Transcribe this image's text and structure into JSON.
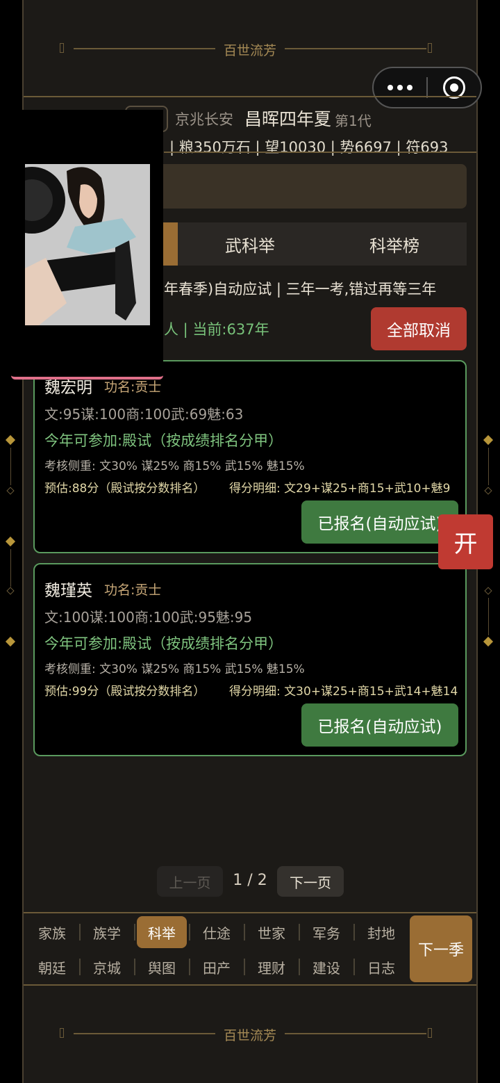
{
  "header_title": "百世流芳",
  "footer_title": "百世流芳",
  "status": {
    "location": "京兆长安",
    "era": "昌晖四年夏",
    "generation": "第1代",
    "stats": "| 粮350万石 | 望10030 | 势6697 | 符693"
  },
  "tabs": [
    {
      "label": ""
    },
    {
      "label": "武科举"
    },
    {
      "label": "科举榜"
    }
  ],
  "info": {
    "line1": "年春季)自动应试 | 三年一考,错过再等三年",
    "line2": "人 | 当前:637年",
    "cancel_all": "全部取消"
  },
  "candidates": [
    {
      "name": "魏宏明",
      "rank": "功名:贡士",
      "attrs": "文:95谋:100商:100武:69魅:63",
      "eligible": "今年可参加:殿试（按成绩排名分甲）",
      "weights": "考核侧重: 文30% 谋25% 商15% 武15% 魅15%",
      "estimate": "预估:88分（殿试按分数排名）",
      "detail": "得分明细: 文29+谋25+商15+武10+魅9",
      "button": "已报名(自动应试)"
    },
    {
      "name": "魏瑾英",
      "rank": "功名:贡士",
      "attrs": "文:100谋:100商:100武:95魅:95",
      "eligible": "今年可参加:殿试（按成绩排名分甲）",
      "weights": "考核侧重: 文30% 谋25% 商15% 武15% 魅15%",
      "estimate": "预估:99分（殿试按分数排名）",
      "detail": "得分明细: 文30+谋25+商15+武14+魅14",
      "button": "已报名(自动应试)"
    }
  ],
  "open_button": "开",
  "pager": {
    "prev": "上一页",
    "current": "1 / 2",
    "next": "下一页"
  },
  "nav": {
    "row1": [
      "家族",
      "族学",
      "科举",
      "仕途",
      "世家",
      "军务",
      "封地"
    ],
    "row2": [
      "朝廷",
      "京城",
      "舆图",
      "田产",
      "理财",
      "建设",
      "日志"
    ],
    "active": "科举",
    "next_season": "下一季"
  },
  "colors": {
    "accent": "#9a6d34",
    "danger": "#b03a30",
    "success": "#3f7a40",
    "border": "#6b5a38"
  }
}
